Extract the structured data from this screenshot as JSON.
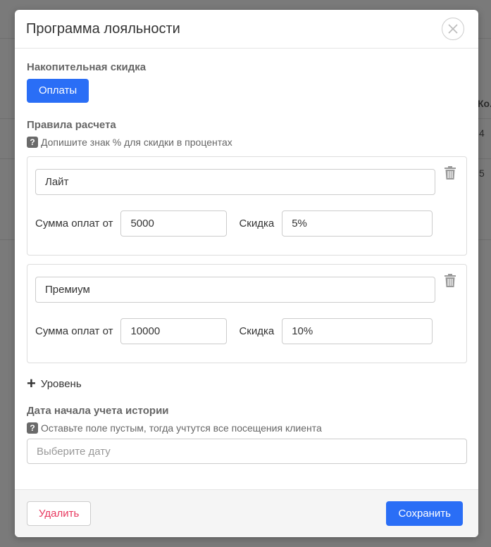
{
  "modal": {
    "title": "Программа лояльности",
    "close_icon": "close-icon"
  },
  "accumulative": {
    "label": "Накопительная скидка",
    "button_label": "Оплаты"
  },
  "rules": {
    "label": "Правила расчета",
    "hint": "Допишите знак % для скидки в процентах",
    "levels": [
      {
        "name": "Лайт",
        "sum_label": "Сумма оплат от",
        "sum": "5000",
        "discount_label": "Скидка",
        "discount": "5%"
      },
      {
        "name": "Премиум",
        "sum_label": "Сумма оплат от",
        "sum": "10000",
        "discount_label": "Скидка",
        "discount": "10%"
      }
    ],
    "add_level_label": "Уровень"
  },
  "history": {
    "label": "Дата начала учета истории",
    "hint": "Оставьте поле пустым, тогда учтутся все посещения клиента",
    "date_placeholder": "Выберите дату"
  },
  "footer": {
    "delete_label": "Удалить",
    "save_label": "Сохранить"
  },
  "background": {
    "col_header": "Ко.",
    "cell_1": "4",
    "cell_2": "5"
  },
  "colors": {
    "primary": "#2a6ef6",
    "danger": "#e8375e"
  }
}
